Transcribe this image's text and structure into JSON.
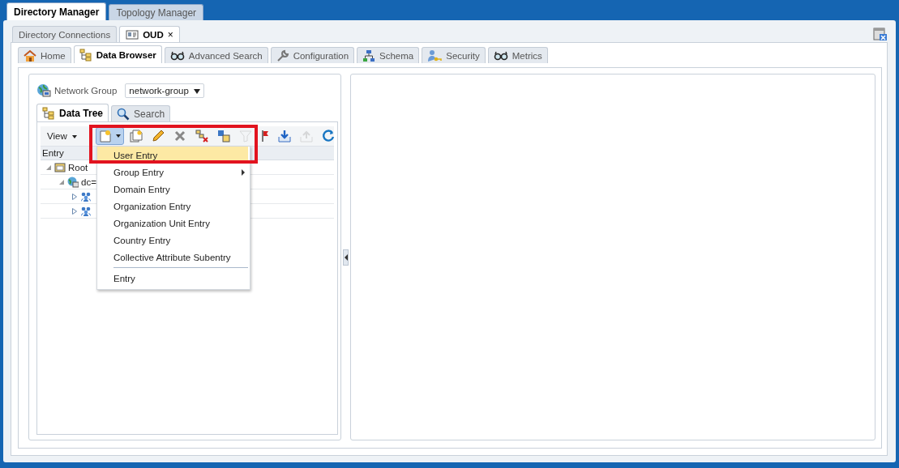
{
  "app_tabs": [
    {
      "label": "Directory Manager",
      "selected": true
    },
    {
      "label": "Topology Manager",
      "selected": false
    }
  ],
  "connection_tabs": [
    {
      "label": "Directory Connections",
      "selected": false,
      "closable": false
    },
    {
      "label": "OUD",
      "selected": true,
      "closable": true,
      "close_glyph": "×"
    }
  ],
  "section_tabs": [
    {
      "label": "Home",
      "kind": "home",
      "selected": false
    },
    {
      "label": "Data Browser",
      "kind": "tree",
      "selected": true
    },
    {
      "label": "Advanced Search",
      "kind": "glasses",
      "selected": false
    },
    {
      "label": "Configuration",
      "kind": "wrench",
      "selected": false
    },
    {
      "label": "Schema",
      "kind": "schema",
      "selected": false
    },
    {
      "label": "Security",
      "kind": "security",
      "selected": false
    },
    {
      "label": "Metrics",
      "kind": "glasses",
      "selected": false
    }
  ],
  "network_group": {
    "label": "Network Group",
    "value": "network-group"
  },
  "browser_tabs": [
    {
      "label": "Data Tree",
      "kind": "tree",
      "selected": true
    },
    {
      "label": "Search",
      "kind": "search",
      "selected": false
    }
  ],
  "toolbar": {
    "view_menu": "View",
    "buttons": [
      {
        "kind": "new",
        "disabled": false,
        "pressed": true
      },
      {
        "kind": "new-from",
        "disabled": false,
        "pressed": false
      },
      {
        "kind": "edit",
        "disabled": false,
        "pressed": false
      },
      {
        "kind": "delete",
        "disabled": false,
        "pressed": false
      },
      {
        "kind": "delete-tree",
        "disabled": false,
        "pressed": false
      },
      {
        "kind": "copy",
        "disabled": false,
        "pressed": false
      },
      {
        "kind": "filter",
        "disabled": true,
        "pressed": false
      },
      {
        "kind": "flag",
        "disabled": false,
        "pressed": false
      },
      {
        "kind": "import",
        "disabled": false,
        "pressed": false
      },
      {
        "kind": "export",
        "disabled": true,
        "pressed": false
      },
      {
        "kind": "refresh",
        "disabled": false,
        "pressed": false
      }
    ]
  },
  "tree": {
    "column": "Entry",
    "nodes": [
      {
        "label": "Root",
        "kind": "root",
        "expanded": true,
        "children": [
          {
            "label": "dc=",
            "kind": "domain",
            "expanded": true,
            "children": [
              {
                "kind": "group",
                "expanded": false
              },
              {
                "kind": "group",
                "expanded": false
              }
            ]
          }
        ]
      }
    ]
  },
  "menu": [
    {
      "label": "User Entry",
      "selected": true,
      "submenu": false
    },
    {
      "label": "Group Entry",
      "selected": false,
      "submenu": true
    },
    {
      "label": "Domain Entry",
      "selected": false,
      "submenu": false
    },
    {
      "label": "Organization Entry",
      "selected": false,
      "submenu": false
    },
    {
      "label": "Organization Unit Entry",
      "selected": false,
      "submenu": false
    },
    {
      "label": "Country Entry",
      "selected": false,
      "submenu": false
    },
    {
      "label": "Collective Attribute Subentry",
      "selected": false,
      "submenu": false,
      "separator_after": true
    },
    {
      "label": "Entry",
      "selected": false,
      "submenu": false
    }
  ]
}
